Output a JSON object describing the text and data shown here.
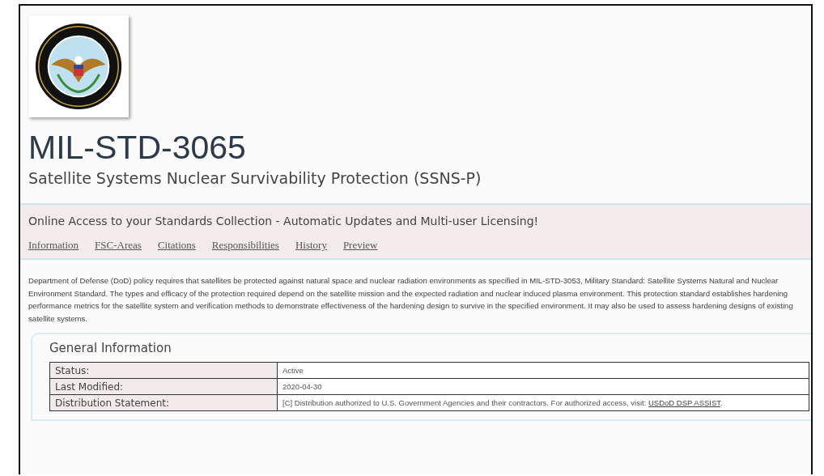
{
  "header": {
    "title": "MIL-STD-3065",
    "subtitle": "Satellite Systems Nuclear Survivability Protection (SSNS-P)"
  },
  "promo": "Online Access to your Standards Collection - Automatic Updates and Multi-user Licensing!",
  "tabs": [
    {
      "label": "Information"
    },
    {
      "label": "FSC-Areas"
    },
    {
      "label": "Citations"
    },
    {
      "label": "Responsibilities"
    },
    {
      "label": "History"
    },
    {
      "label": "Preview"
    }
  ],
  "description": "Department of Defense (DoD) policy requires that satellites be protected against natural space and nuclear radiation environments as specified in MIL-STD-3053, Military Standard: Satellite Systems Natural and Nuclear Environment Standard. The types and efficacy of the protection required depend on the satellite mission and the expected radiation and nuclear induced plasma environment. This protection standard establishes hardening performance metrics for the satellite system and verification methods to demonstrate effectiveness of the hardening design to survive in the specified environment. It may also be used to assess hardening designs of existing satellite systems.",
  "general_information": {
    "title": "General Information",
    "rows": [
      {
        "label": "Status:",
        "value": "Active"
      },
      {
        "label": "Last Modified:",
        "value": "2020-04-30"
      },
      {
        "label": "Distribution Statement:",
        "value": "[C] Distribution authorized to U.S. Government Agencies and their contractors. For authorized access, visit: ",
        "link": "USDoD DSP ASSIST",
        "after": "."
      }
    ]
  }
}
